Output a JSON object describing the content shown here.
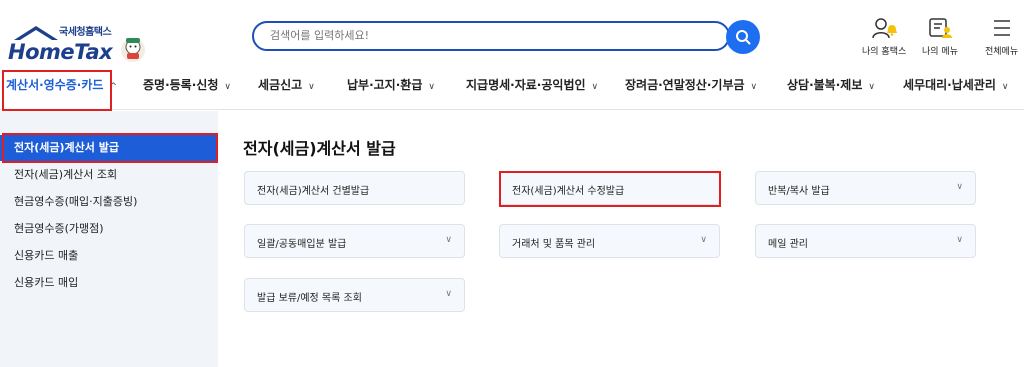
{
  "logo": {
    "sub": "국세청홈택스",
    "main": "HomeTax"
  },
  "search": {
    "placeholder": "검색어를 입력하세요!"
  },
  "util": [
    {
      "label": "나의 홈택스",
      "icon": "user-bell-icon"
    },
    {
      "label": "나의 메뉴",
      "icon": "my-menu-icon"
    },
    {
      "label": "전체메뉴",
      "icon": "hamburger-icon"
    }
  ],
  "gnb": [
    {
      "label": "계산서·영수증·카드",
      "chevron": "^"
    },
    {
      "label": "증명·등록·신청",
      "chevron": "v"
    },
    {
      "label": "세금신고",
      "chevron": "v"
    },
    {
      "label": "납부·고지·환급",
      "chevron": "v"
    },
    {
      "label": "지급명세·자료·공익법인",
      "chevron": "v"
    },
    {
      "label": "장려금·연말정산·기부금",
      "chevron": "v"
    },
    {
      "label": "상담·불복·제보",
      "chevron": "v"
    },
    {
      "label": "세무대리·납세관리",
      "chevron": "v"
    }
  ],
  "sidebar": [
    {
      "label": "전자(세금)계산서 발급"
    },
    {
      "label": "전자(세금)계산서 조회"
    },
    {
      "label": "현금영수증(매입·지출증빙)"
    },
    {
      "label": "현금영수증(가맹점)"
    },
    {
      "label": "신용카드 매출"
    },
    {
      "label": "신용카드 매입"
    }
  ],
  "main": {
    "title": "전자(세금)계산서 발급",
    "cards": [
      {
        "label": "전자(세금)계산서 건별발급",
        "chevron": ""
      },
      {
        "label": "전자(세금)계산서 수정발급",
        "chevron": ""
      },
      {
        "label": "반복/복사 발급",
        "chevron": "v"
      },
      {
        "label": "일괄/공동매입분 발급",
        "chevron": "v"
      },
      {
        "label": "거래처 및 품목 관리",
        "chevron": "v"
      },
      {
        "label": "메일 관리",
        "chevron": "v"
      },
      {
        "label": "발급 보류/예정 목록 조회",
        "chevron": "v"
      }
    ]
  },
  "colors": {
    "brand": "#1d3f8c",
    "accent": "#1d5ed8",
    "highlight": "#e02020",
    "sidebar_bg": "#f1f5fa"
  }
}
